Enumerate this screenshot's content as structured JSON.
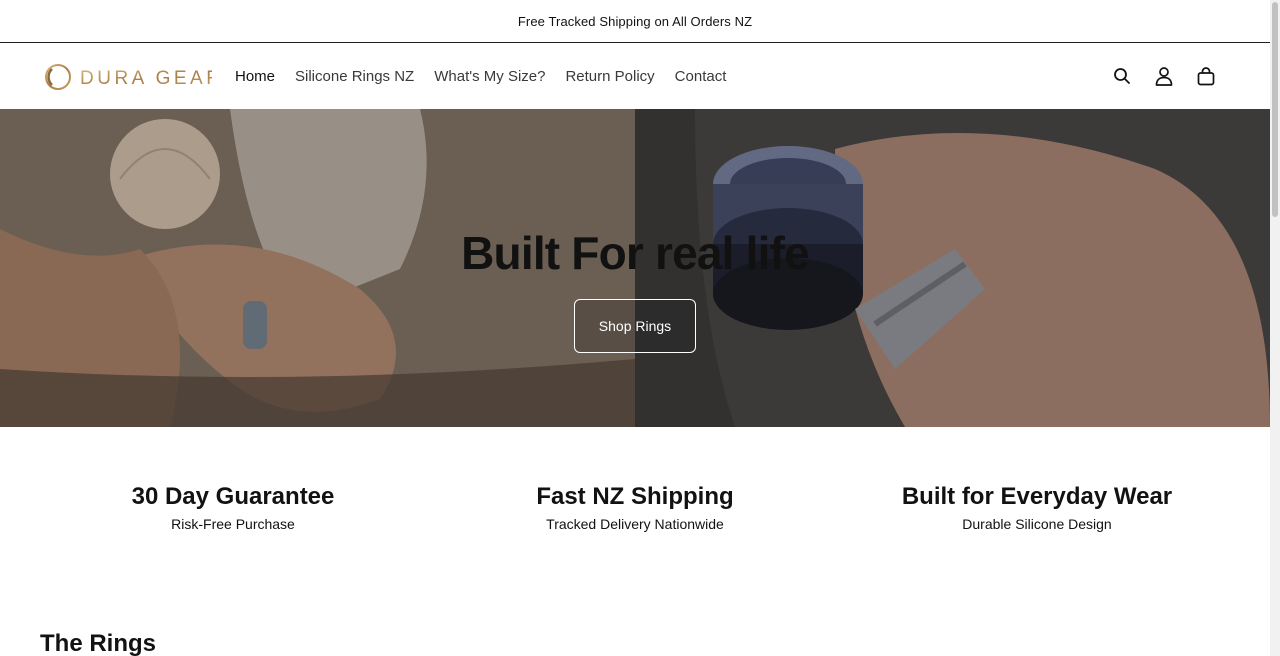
{
  "announcement": {
    "text": "Free Tracked Shipping on All Orders NZ"
  },
  "header": {
    "brand": "DURA GEAR",
    "nav": [
      {
        "label": "Home",
        "active": true
      },
      {
        "label": "Silicone Rings NZ",
        "active": false
      },
      {
        "label": "What's My Size?",
        "active": false
      },
      {
        "label": "Return Policy",
        "active": false
      },
      {
        "label": "Contact",
        "active": false
      }
    ],
    "icons": [
      "search-icon",
      "account-icon",
      "cart-icon"
    ]
  },
  "hero": {
    "title": "Built For real life",
    "button_label": "Shop Rings"
  },
  "features": [
    {
      "title": "30 Day Guarantee",
      "subtitle": "Risk-Free Purchase"
    },
    {
      "title": "Fast NZ Shipping",
      "subtitle": "Tracked Delivery Nationwide"
    },
    {
      "title": "Built for Everyday Wear",
      "subtitle": "Durable Silicone Design"
    }
  ],
  "section": {
    "heading": "The Rings"
  },
  "colors": {
    "brand_gold": "#b8925a",
    "text": "#121212"
  }
}
